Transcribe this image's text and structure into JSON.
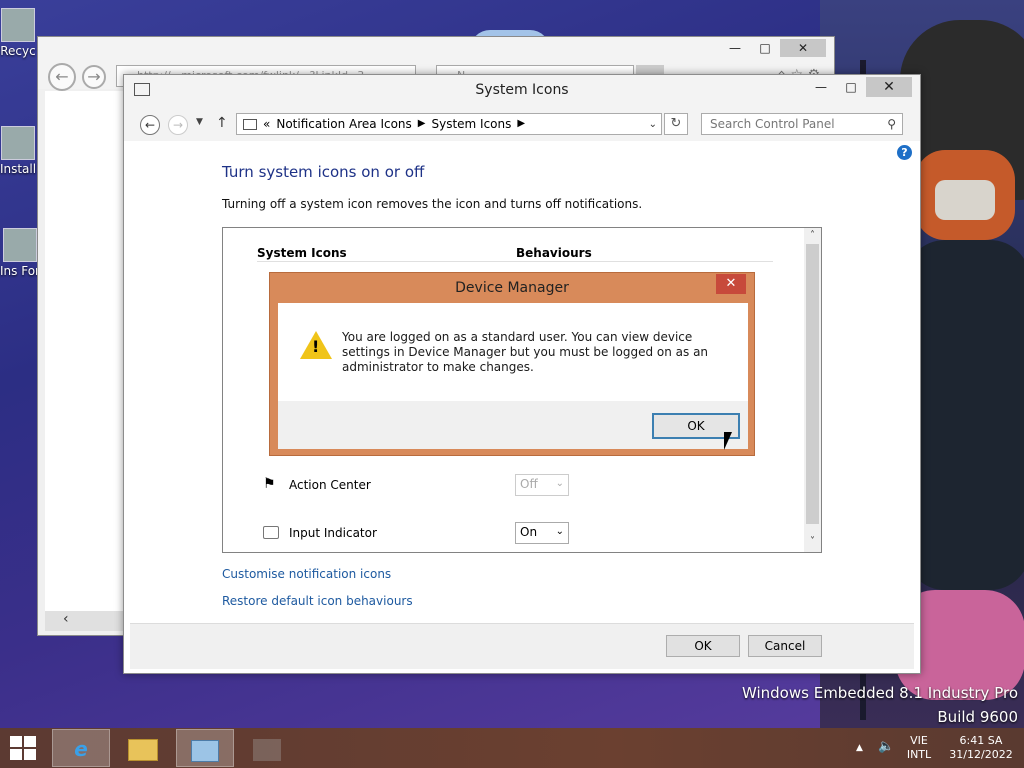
{
  "desktop": {
    "icons": [
      {
        "label": "Recyc"
      },
      {
        "label": "Install"
      },
      {
        "label": "Ins For"
      }
    ],
    "watermark_line1": "Windows Embedded 8.1 Industry Pro",
    "watermark_line2": "Build 9600"
  },
  "browser": {
    "address_text": "http://...microsoft.com/fwlink/...?LinkId=3...",
    "tab_text": "N..."
  },
  "control_panel": {
    "window_title": "System Icons",
    "breadcrumb_root": "«",
    "breadcrumb": [
      "Notification Area Icons",
      "System Icons"
    ],
    "search_placeholder": "Search Control Panel",
    "heading": "Turn system icons on or off",
    "description": "Turning off a system icon removes the icon and turns off notifications.",
    "columns": {
      "icon": "System Icons",
      "behaviour": "Behaviours"
    },
    "rows": [
      {
        "label": "Action Center",
        "value": "Off",
        "disabled": true
      },
      {
        "label": "Input Indicator",
        "value": "On",
        "disabled": false
      }
    ],
    "links": {
      "customise": "Customise notification icons",
      "restore": "Restore default icon behaviours"
    },
    "buttons": {
      "ok": "OK",
      "cancel": "Cancel"
    }
  },
  "dialog": {
    "title": "Device Manager",
    "message": "You are logged on as a standard user. You can view device settings in Device Manager but you must be logged on as an administrator to make changes.",
    "ok": "OK"
  },
  "taskbar": {
    "lang_line1": "VIE",
    "lang_line2": "INTL",
    "time": "6:41 SA",
    "date": "31/12/2022"
  },
  "colors": {
    "heading_blue": "#1e3287",
    "link_blue": "#1e5aa0",
    "dialog_frame": "#d88a5a",
    "close_red": "#c74a3b",
    "taskbar": "#6b4030"
  }
}
